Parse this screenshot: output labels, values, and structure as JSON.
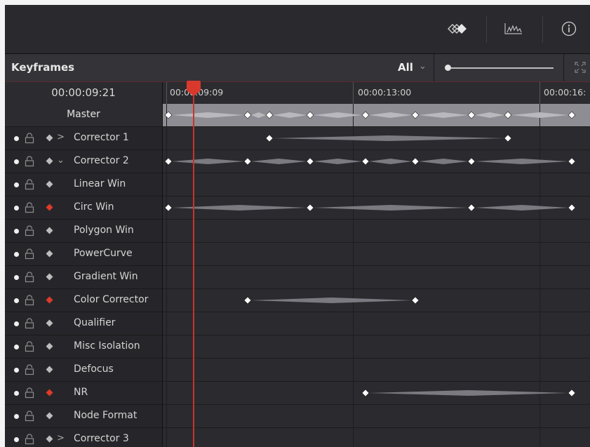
{
  "toolbar": {
    "icons": [
      "keyframe-diamonds-icon",
      "curves-icon",
      "info-icon"
    ]
  },
  "panel": {
    "title": "Keyframes",
    "filter_value": "All",
    "filter_chevron": "⌄",
    "zoom_slider_level": 0.0,
    "fullscreen_icon": "expand-icon"
  },
  "timecode": "00:00:09:21",
  "ruler_labels": [
    "00:00:09:09",
    "00:00:13:00",
    "00:00:16:"
  ],
  "tracks": [
    {
      "name": "Master",
      "master": true,
      "dot": false,
      "lock": false,
      "keyframe_color": "",
      "expander": ""
    },
    {
      "name": "Corrector 1",
      "master": false,
      "dot": true,
      "lock": true,
      "keyframe_color": "gray",
      "expander": ">"
    },
    {
      "name": "Corrector 2",
      "master": false,
      "dot": true,
      "lock": true,
      "keyframe_color": "gray",
      "expander": "⌄"
    },
    {
      "name": "Linear Win",
      "master": false,
      "dot": true,
      "lock": true,
      "keyframe_color": "gray",
      "expander": ""
    },
    {
      "name": "Circ Win",
      "master": false,
      "dot": true,
      "lock": true,
      "keyframe_color": "red",
      "expander": ""
    },
    {
      "name": "Polygon Win",
      "master": false,
      "dot": true,
      "lock": true,
      "keyframe_color": "gray",
      "expander": ""
    },
    {
      "name": "PowerCurve",
      "master": false,
      "dot": true,
      "lock": true,
      "keyframe_color": "gray",
      "expander": ""
    },
    {
      "name": "Gradient Win",
      "master": false,
      "dot": true,
      "lock": true,
      "keyframe_color": "gray",
      "expander": ""
    },
    {
      "name": "Color Corrector",
      "master": false,
      "dot": true,
      "lock": true,
      "keyframe_color": "red",
      "expander": ""
    },
    {
      "name": "Qualifier",
      "master": false,
      "dot": true,
      "lock": true,
      "keyframe_color": "gray",
      "expander": ""
    },
    {
      "name": "Misc Isolation",
      "master": false,
      "dot": true,
      "lock": true,
      "keyframe_color": "gray",
      "expander": ""
    },
    {
      "name": "Defocus",
      "master": false,
      "dot": true,
      "lock": true,
      "keyframe_color": "gray",
      "expander": ""
    },
    {
      "name": "NR",
      "master": false,
      "dot": true,
      "lock": true,
      "keyframe_color": "red",
      "expander": ""
    },
    {
      "name": "Node Format",
      "master": false,
      "dot": true,
      "lock": true,
      "keyframe_color": "gray",
      "expander": ""
    },
    {
      "name": "Corrector 3",
      "master": false,
      "dot": true,
      "lock": true,
      "keyframe_color": "gray",
      "expander": ">"
    }
  ],
  "colors": {
    "playhead": "#d9392d",
    "keyframe_red": "#e03a2a",
    "master_band": "#8d8d93"
  }
}
